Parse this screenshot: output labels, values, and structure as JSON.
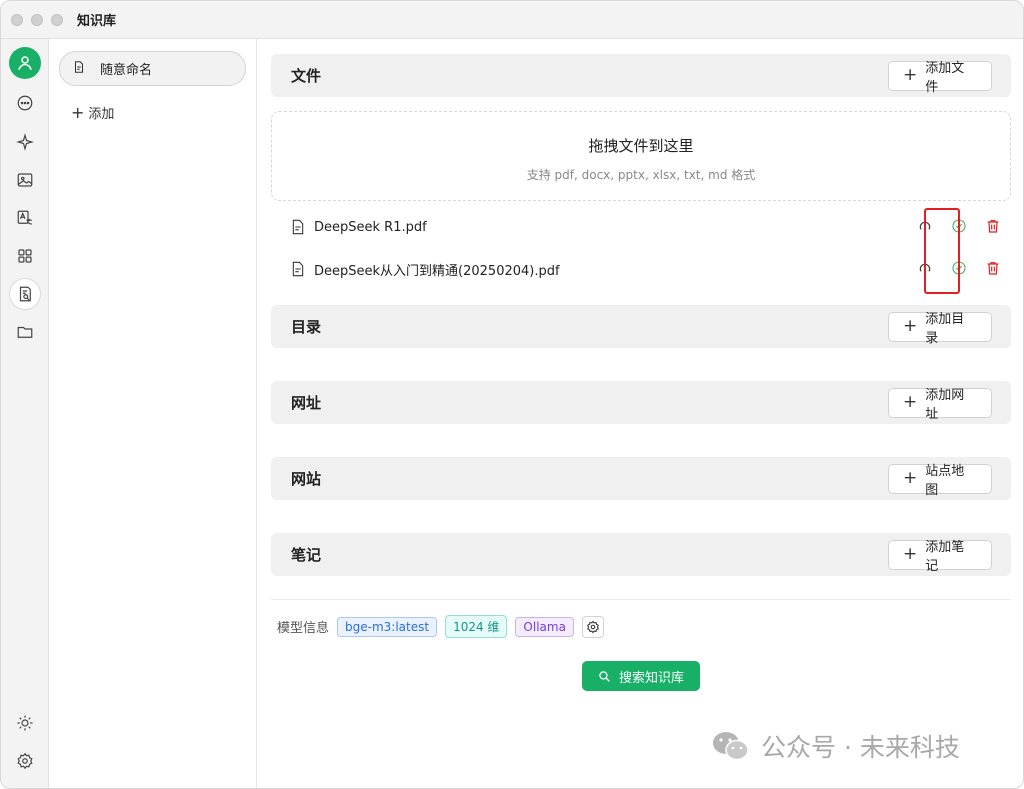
{
  "window": {
    "title": "知识库"
  },
  "rail": {
    "items": [
      {
        "icon": "user-avatar-icon"
      },
      {
        "icon": "chat-icon"
      },
      {
        "icon": "sparkle-icon"
      },
      {
        "icon": "image-icon"
      },
      {
        "icon": "translate-icon"
      },
      {
        "icon": "apps-grid-icon"
      },
      {
        "icon": "knowledge-base-icon"
      },
      {
        "icon": "folder-icon"
      },
      {
        "icon": "theme-sun-icon"
      },
      {
        "icon": "settings-gear-icon"
      }
    ]
  },
  "sidebar": {
    "items": [
      {
        "label": "随意命名"
      }
    ],
    "add_label": "添加"
  },
  "sections": {
    "files": {
      "title": "文件",
      "button": "添加文件"
    },
    "dropzone": {
      "title": "拖拽文件到这里",
      "subtitle": "支持 pdf, docx, pptx, xlsx, txt, md 格式"
    },
    "file_list": [
      {
        "name": "DeepSeek R1.pdf",
        "status": "done"
      },
      {
        "name": "DeepSeek从入门到精通(20250204).pdf",
        "status": "done"
      }
    ],
    "directory": {
      "title": "目录",
      "button": "添加目录"
    },
    "url": {
      "title": "网址",
      "button": "添加网址"
    },
    "website": {
      "title": "网站",
      "button": "站点地图"
    },
    "notes": {
      "title": "笔记",
      "button": "添加笔记"
    }
  },
  "model": {
    "label": "模型信息",
    "tags": [
      "bge-m3:latest",
      "1024 维",
      "Ollama"
    ]
  },
  "search_button": "搜索知识库",
  "watermark": "公众号 · 未来科技",
  "colors": {
    "accent": "#17b066",
    "danger": "#e02020",
    "success": "#3fae5a"
  }
}
